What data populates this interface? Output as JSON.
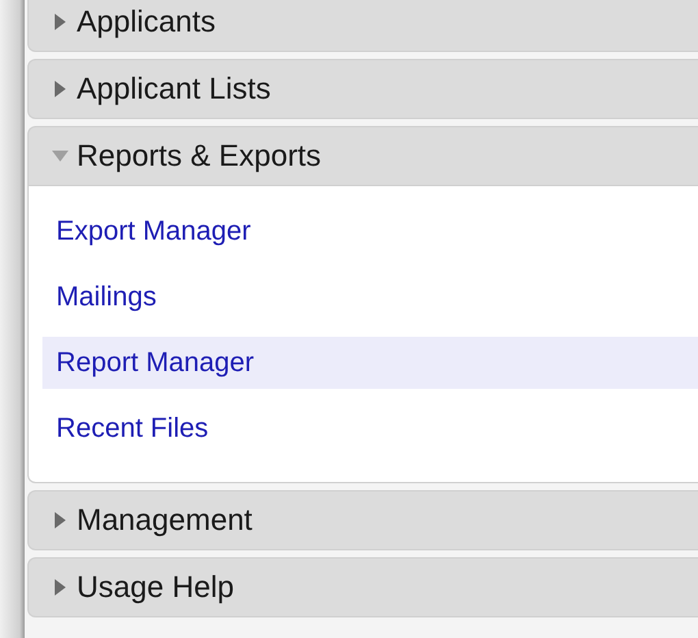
{
  "sections": [
    {
      "title": "Applicants",
      "expanded": false
    },
    {
      "title": "Applicant Lists",
      "expanded": false
    },
    {
      "title": "Reports & Exports",
      "expanded": true,
      "items": [
        {
          "label": "Export Manager",
          "selected": false
        },
        {
          "label": "Mailings",
          "selected": false
        },
        {
          "label": "Report Manager",
          "selected": true
        },
        {
          "label": "Recent Files",
          "selected": false
        }
      ]
    },
    {
      "title": "Management",
      "expanded": false
    },
    {
      "title": "Usage Help",
      "expanded": false
    }
  ]
}
